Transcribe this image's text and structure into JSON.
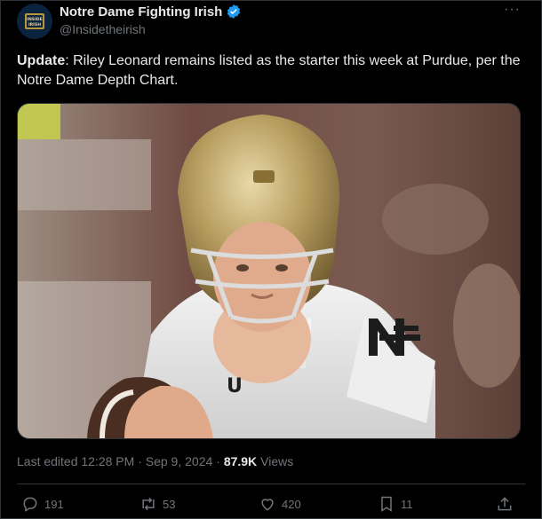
{
  "author": {
    "display_name": "Notre Dame Fighting Irish",
    "handle": "@Insidetheirish",
    "verified": true,
    "avatar_text": "INSIDE THE IRISH"
  },
  "post": {
    "lead": "Update",
    "body": ": Riley Leonard remains listed as the starter this week at Purdue, per the Notre Dame Depth Chart."
  },
  "meta": {
    "edited": "Last edited 12:28 PM · Sep 9, 2024 · ",
    "views_count": "87.9K",
    "views_label": "Views"
  },
  "actions": {
    "replies": "191",
    "reposts": "53",
    "likes": "420",
    "bookmarks": "11"
  },
  "colors": {
    "background": "#000000",
    "text": "#e7e9ea",
    "muted": "#71767b",
    "verified": "#1d9bf0",
    "border": "#2f3336"
  },
  "icons": [
    "verified-badge-icon",
    "more-icon",
    "reply-icon",
    "repost-icon",
    "like-icon",
    "bookmark-icon",
    "share-icon"
  ]
}
